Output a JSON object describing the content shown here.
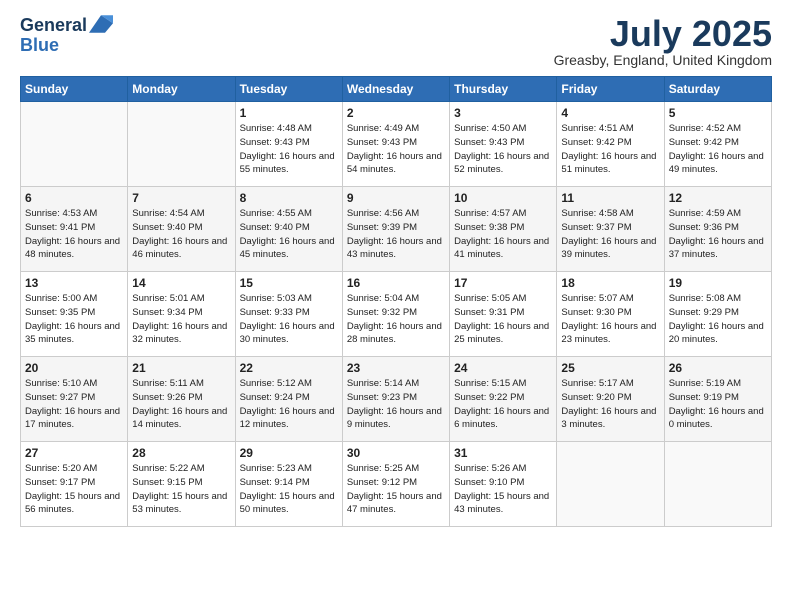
{
  "header": {
    "logo_line1": "General",
    "logo_line2": "Blue",
    "month": "July 2025",
    "location": "Greasby, England, United Kingdom"
  },
  "days_of_week": [
    "Sunday",
    "Monday",
    "Tuesday",
    "Wednesday",
    "Thursday",
    "Friday",
    "Saturday"
  ],
  "weeks": [
    [
      {
        "day": "",
        "sunrise": "",
        "sunset": "",
        "daylight": ""
      },
      {
        "day": "",
        "sunrise": "",
        "sunset": "",
        "daylight": ""
      },
      {
        "day": "1",
        "sunrise": "Sunrise: 4:48 AM",
        "sunset": "Sunset: 9:43 PM",
        "daylight": "Daylight: 16 hours and 55 minutes."
      },
      {
        "day": "2",
        "sunrise": "Sunrise: 4:49 AM",
        "sunset": "Sunset: 9:43 PM",
        "daylight": "Daylight: 16 hours and 54 minutes."
      },
      {
        "day": "3",
        "sunrise": "Sunrise: 4:50 AM",
        "sunset": "Sunset: 9:43 PM",
        "daylight": "Daylight: 16 hours and 52 minutes."
      },
      {
        "day": "4",
        "sunrise": "Sunrise: 4:51 AM",
        "sunset": "Sunset: 9:42 PM",
        "daylight": "Daylight: 16 hours and 51 minutes."
      },
      {
        "day": "5",
        "sunrise": "Sunrise: 4:52 AM",
        "sunset": "Sunset: 9:42 PM",
        "daylight": "Daylight: 16 hours and 49 minutes."
      }
    ],
    [
      {
        "day": "6",
        "sunrise": "Sunrise: 4:53 AM",
        "sunset": "Sunset: 9:41 PM",
        "daylight": "Daylight: 16 hours and 48 minutes."
      },
      {
        "day": "7",
        "sunrise": "Sunrise: 4:54 AM",
        "sunset": "Sunset: 9:40 PM",
        "daylight": "Daylight: 16 hours and 46 minutes."
      },
      {
        "day": "8",
        "sunrise": "Sunrise: 4:55 AM",
        "sunset": "Sunset: 9:40 PM",
        "daylight": "Daylight: 16 hours and 45 minutes."
      },
      {
        "day": "9",
        "sunrise": "Sunrise: 4:56 AM",
        "sunset": "Sunset: 9:39 PM",
        "daylight": "Daylight: 16 hours and 43 minutes."
      },
      {
        "day": "10",
        "sunrise": "Sunrise: 4:57 AM",
        "sunset": "Sunset: 9:38 PM",
        "daylight": "Daylight: 16 hours and 41 minutes."
      },
      {
        "day": "11",
        "sunrise": "Sunrise: 4:58 AM",
        "sunset": "Sunset: 9:37 PM",
        "daylight": "Daylight: 16 hours and 39 minutes."
      },
      {
        "day": "12",
        "sunrise": "Sunrise: 4:59 AM",
        "sunset": "Sunset: 9:36 PM",
        "daylight": "Daylight: 16 hours and 37 minutes."
      }
    ],
    [
      {
        "day": "13",
        "sunrise": "Sunrise: 5:00 AM",
        "sunset": "Sunset: 9:35 PM",
        "daylight": "Daylight: 16 hours and 35 minutes."
      },
      {
        "day": "14",
        "sunrise": "Sunrise: 5:01 AM",
        "sunset": "Sunset: 9:34 PM",
        "daylight": "Daylight: 16 hours and 32 minutes."
      },
      {
        "day": "15",
        "sunrise": "Sunrise: 5:03 AM",
        "sunset": "Sunset: 9:33 PM",
        "daylight": "Daylight: 16 hours and 30 minutes."
      },
      {
        "day": "16",
        "sunrise": "Sunrise: 5:04 AM",
        "sunset": "Sunset: 9:32 PM",
        "daylight": "Daylight: 16 hours and 28 minutes."
      },
      {
        "day": "17",
        "sunrise": "Sunrise: 5:05 AM",
        "sunset": "Sunset: 9:31 PM",
        "daylight": "Daylight: 16 hours and 25 minutes."
      },
      {
        "day": "18",
        "sunrise": "Sunrise: 5:07 AM",
        "sunset": "Sunset: 9:30 PM",
        "daylight": "Daylight: 16 hours and 23 minutes."
      },
      {
        "day": "19",
        "sunrise": "Sunrise: 5:08 AM",
        "sunset": "Sunset: 9:29 PM",
        "daylight": "Daylight: 16 hours and 20 minutes."
      }
    ],
    [
      {
        "day": "20",
        "sunrise": "Sunrise: 5:10 AM",
        "sunset": "Sunset: 9:27 PM",
        "daylight": "Daylight: 16 hours and 17 minutes."
      },
      {
        "day": "21",
        "sunrise": "Sunrise: 5:11 AM",
        "sunset": "Sunset: 9:26 PM",
        "daylight": "Daylight: 16 hours and 14 minutes."
      },
      {
        "day": "22",
        "sunrise": "Sunrise: 5:12 AM",
        "sunset": "Sunset: 9:24 PM",
        "daylight": "Daylight: 16 hours and 12 minutes."
      },
      {
        "day": "23",
        "sunrise": "Sunrise: 5:14 AM",
        "sunset": "Sunset: 9:23 PM",
        "daylight": "Daylight: 16 hours and 9 minutes."
      },
      {
        "day": "24",
        "sunrise": "Sunrise: 5:15 AM",
        "sunset": "Sunset: 9:22 PM",
        "daylight": "Daylight: 16 hours and 6 minutes."
      },
      {
        "day": "25",
        "sunrise": "Sunrise: 5:17 AM",
        "sunset": "Sunset: 9:20 PM",
        "daylight": "Daylight: 16 hours and 3 minutes."
      },
      {
        "day": "26",
        "sunrise": "Sunrise: 5:19 AM",
        "sunset": "Sunset: 9:19 PM",
        "daylight": "Daylight: 16 hours and 0 minutes."
      }
    ],
    [
      {
        "day": "27",
        "sunrise": "Sunrise: 5:20 AM",
        "sunset": "Sunset: 9:17 PM",
        "daylight": "Daylight: 15 hours and 56 minutes."
      },
      {
        "day": "28",
        "sunrise": "Sunrise: 5:22 AM",
        "sunset": "Sunset: 9:15 PM",
        "daylight": "Daylight: 15 hours and 53 minutes."
      },
      {
        "day": "29",
        "sunrise": "Sunrise: 5:23 AM",
        "sunset": "Sunset: 9:14 PM",
        "daylight": "Daylight: 15 hours and 50 minutes."
      },
      {
        "day": "30",
        "sunrise": "Sunrise: 5:25 AM",
        "sunset": "Sunset: 9:12 PM",
        "daylight": "Daylight: 15 hours and 47 minutes."
      },
      {
        "day": "31",
        "sunrise": "Sunrise: 5:26 AM",
        "sunset": "Sunset: 9:10 PM",
        "daylight": "Daylight: 15 hours and 43 minutes."
      },
      {
        "day": "",
        "sunrise": "",
        "sunset": "",
        "daylight": ""
      },
      {
        "day": "",
        "sunrise": "",
        "sunset": "",
        "daylight": ""
      }
    ]
  ]
}
